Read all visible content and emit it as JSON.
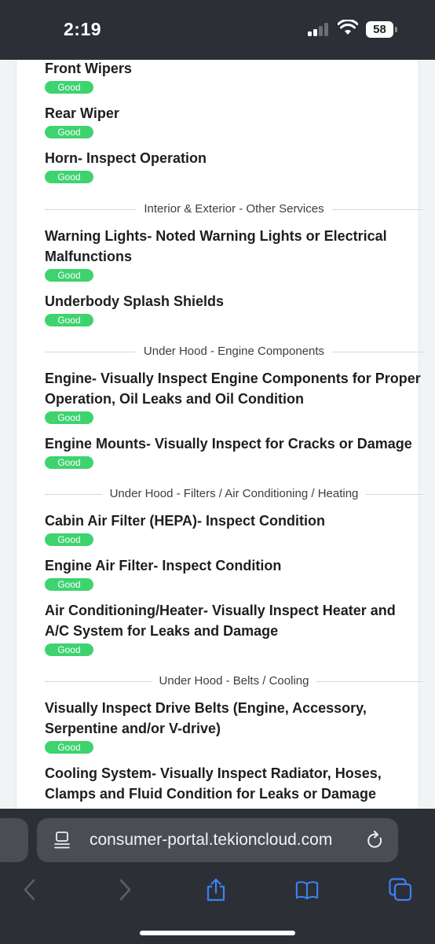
{
  "status_bar": {
    "time": "2:19",
    "battery": "58"
  },
  "inspection": {
    "items_top": [
      {
        "title": "Front Wipers",
        "status": "Good"
      },
      {
        "title": "Rear Wiper",
        "status": "Good"
      },
      {
        "title": "Horn- Inspect Operation",
        "status": "Good"
      }
    ],
    "sections": [
      {
        "heading": "Interior & Exterior - Other Services",
        "items": [
          {
            "title": "Warning Lights- Noted Warning Lights or Electrical Malfunctions",
            "status": "Good"
          },
          {
            "title": "Underbody Splash Shields",
            "status": "Good"
          }
        ]
      },
      {
        "heading": "Under Hood - Engine Components",
        "items": [
          {
            "title": "Engine- Visually Inspect Engine Components for Proper Operation, Oil Leaks and Oil Condition",
            "status": "Good"
          },
          {
            "title": "Engine Mounts- Visually Inspect for Cracks or Damage",
            "status": "Good"
          }
        ]
      },
      {
        "heading": "Under Hood - Filters / Air Conditioning / Heating",
        "items": [
          {
            "title": "Cabin Air Filter (HEPA)- Inspect Condition",
            "status": "Good"
          },
          {
            "title": "Engine Air Filter- Inspect Condition",
            "status": "Good"
          },
          {
            "title": "Air Conditioning/Heater- Visually Inspect Heater and A/C System for Leaks and Damage",
            "status": "Good"
          }
        ]
      },
      {
        "heading": "Under Hood - Belts / Cooling",
        "items": [
          {
            "title": "Visually Inspect Drive Belts (Engine, Accessory, Serpentine and/or V-drive)",
            "status": "Good"
          },
          {
            "title": "Cooling System- Visually Inspect Radiator, Hoses, Clamps and Fluid Condition for Leaks or Damage",
            "status": ""
          }
        ]
      }
    ]
  },
  "browser": {
    "url": "consumer-portal.tekioncloud.com"
  },
  "colors": {
    "badge_good": "#3ed36f",
    "chrome": "#2c2f36",
    "toolbar_icon": "#3b82f6"
  }
}
